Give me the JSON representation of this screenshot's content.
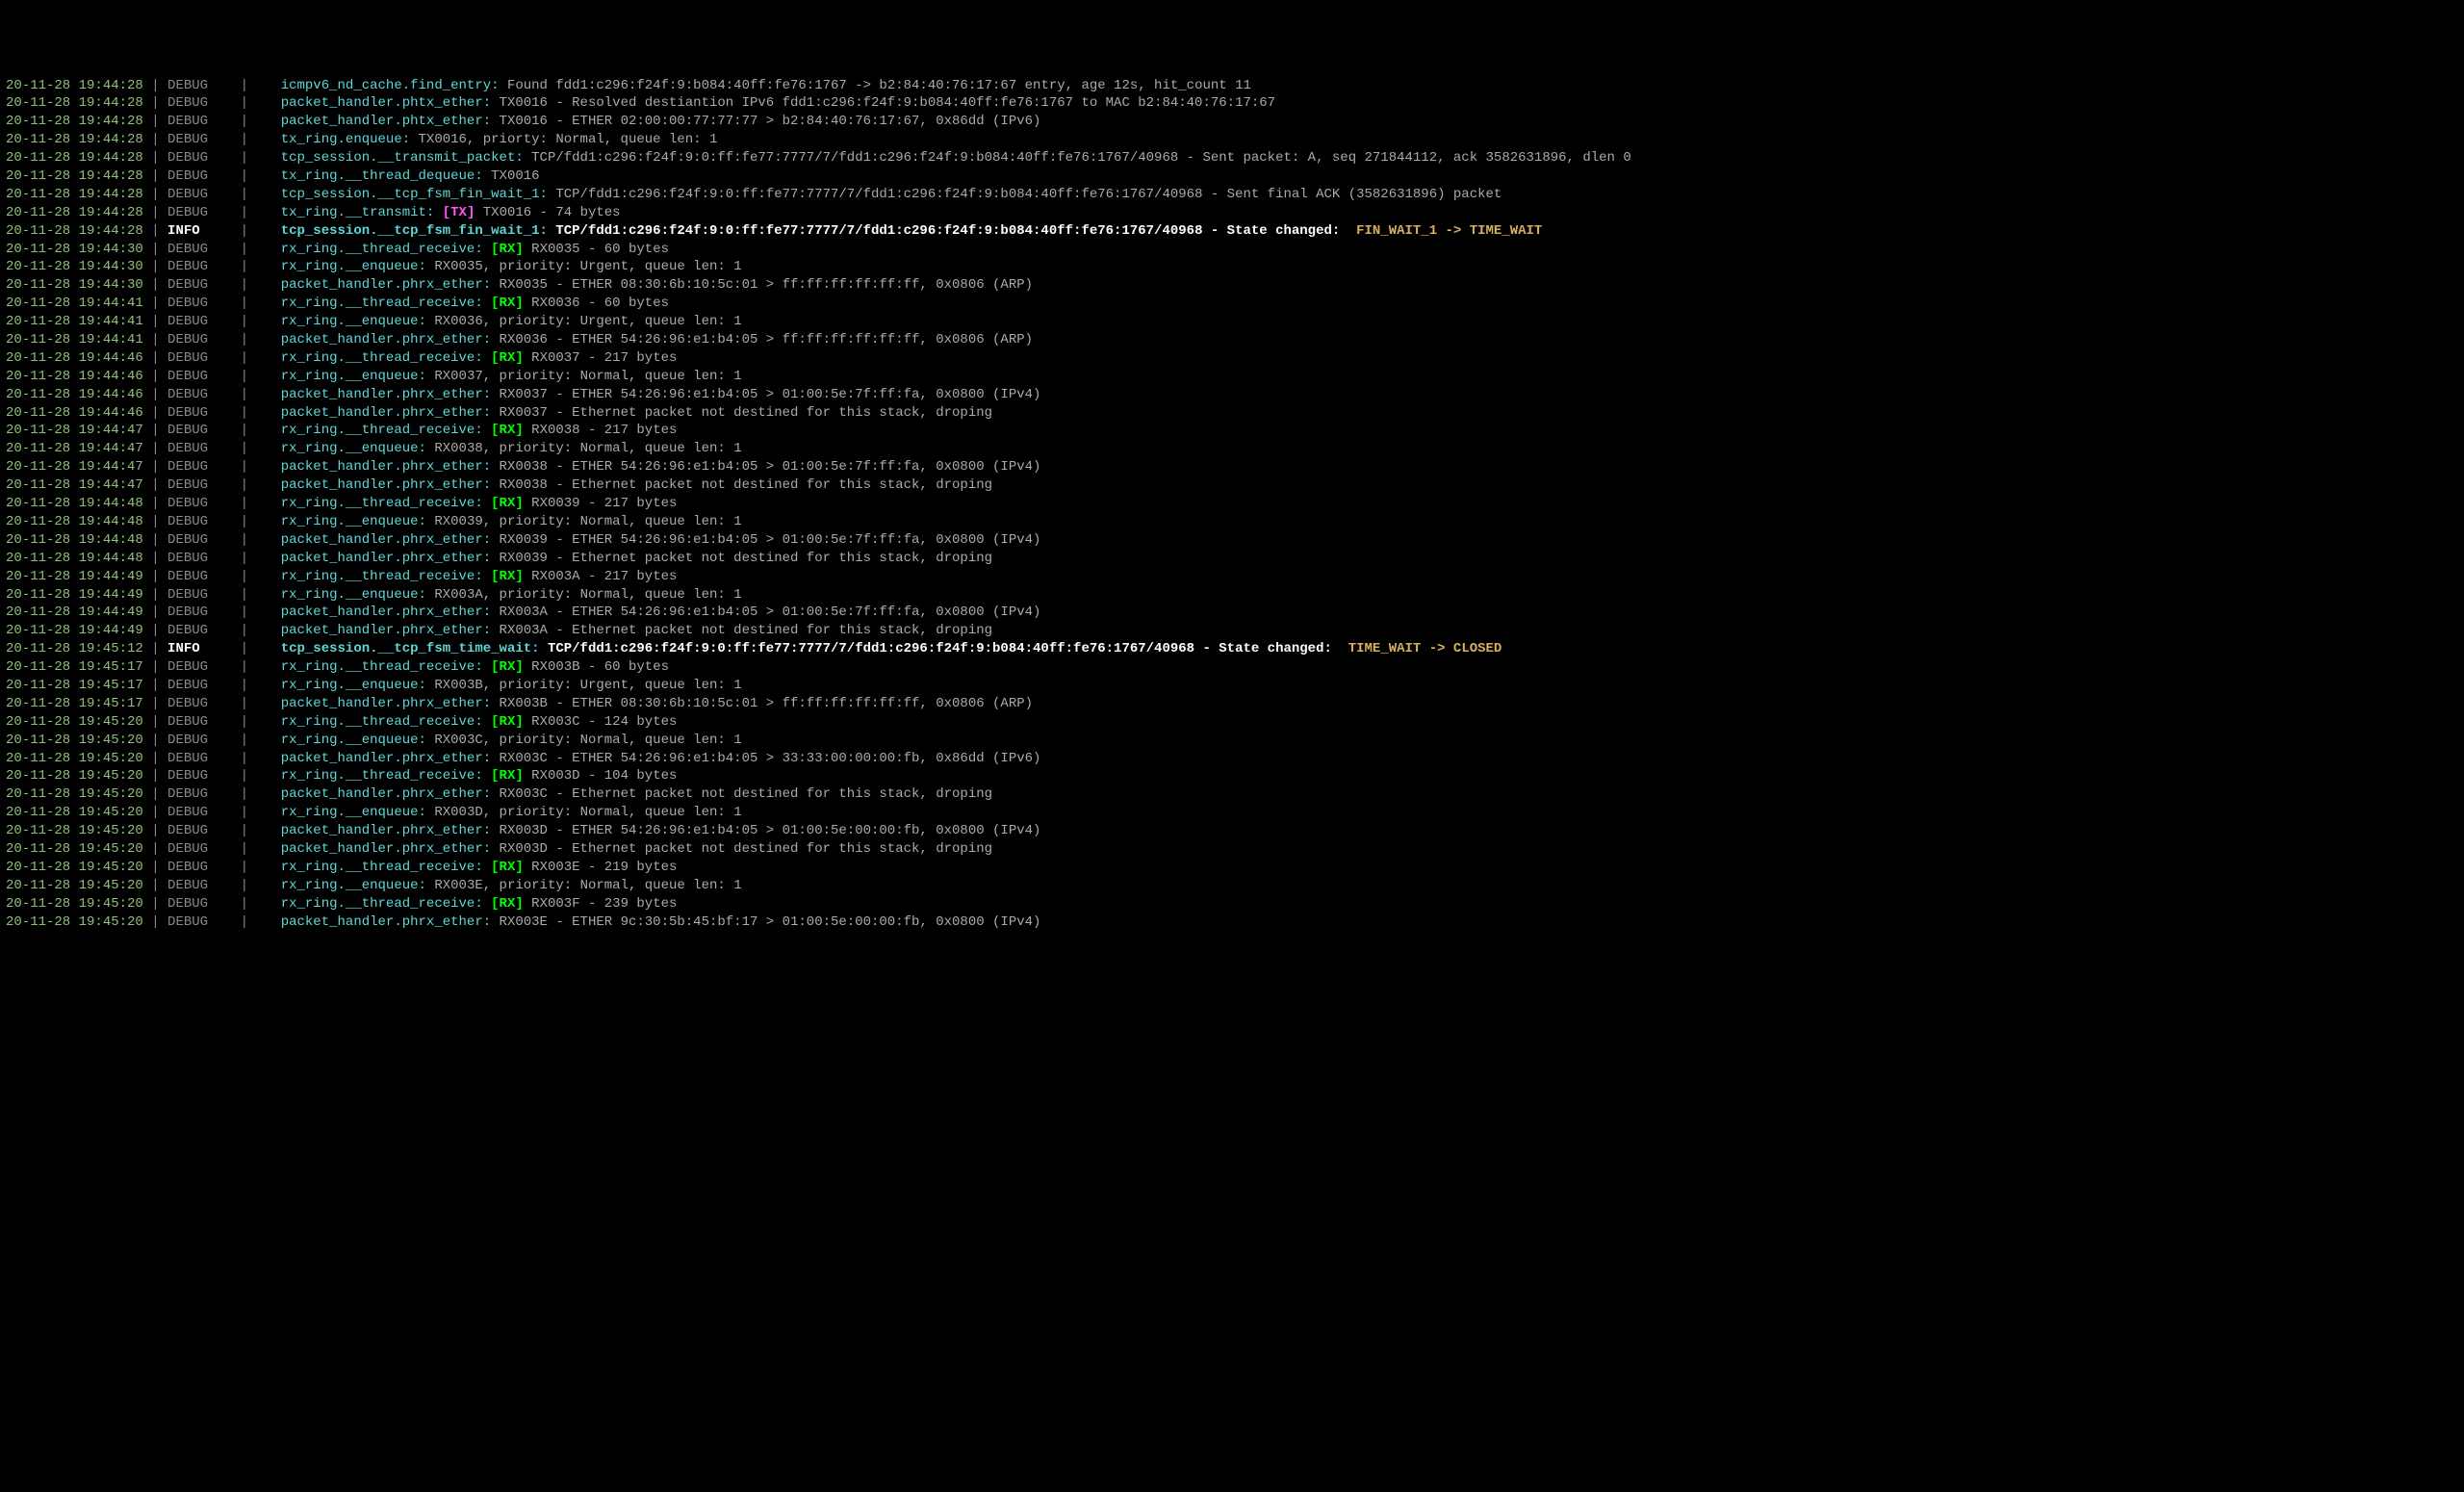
{
  "logs": [
    {
      "ts": "20-11-28 19:44:28",
      "level": "DEBUG",
      "src": "icmpv6_nd_cache.find_entry:",
      "msg": " Found fdd1:c296:f24f:9:b084:40ff:fe76:1767 -> b2:84:40:76:17:67 entry, age 12s, hit_count 11"
    },
    {
      "ts": "20-11-28 19:44:28",
      "level": "DEBUG",
      "src": "packet_handler.phtx_ether:",
      "msg": " TX0016 - Resolved destiantion IPv6 fdd1:c296:f24f:9:b084:40ff:fe76:1767 to MAC b2:84:40:76:17:67"
    },
    {
      "ts": "20-11-28 19:44:28",
      "level": "DEBUG",
      "src": "packet_handler.phtx_ether:",
      "msg": " TX0016 - ETHER 02:00:00:77:77:77 > b2:84:40:76:17:67, 0x86dd (IPv6)"
    },
    {
      "ts": "20-11-28 19:44:28",
      "level": "DEBUG",
      "src": "tx_ring.enqueue:",
      "msg": " TX0016, priorty: Normal, queue len: 1"
    },
    {
      "ts": "20-11-28 19:44:28",
      "level": "DEBUG",
      "src": "tcp_session.__transmit_packet:",
      "msg": " TCP/fdd1:c296:f24f:9:0:ff:fe77:7777/7/fdd1:c296:f24f:9:b084:40ff:fe76:1767/40968 - Sent packet: A, seq 271844112, ack 3582631896, dlen 0"
    },
    {
      "ts": "20-11-28 19:44:28",
      "level": "DEBUG",
      "src": "tx_ring.__thread_dequeue:",
      "msg": " TX0016"
    },
    {
      "ts": "20-11-28 19:44:28",
      "level": "DEBUG",
      "src": "tcp_session.__tcp_fsm_fin_wait_1:",
      "msg": " TCP/fdd1:c296:f24f:9:0:ff:fe77:7777/7/fdd1:c296:f24f:9:b084:40ff:fe76:1767/40968 - Sent final ACK (3582631896) packet"
    },
    {
      "ts": "20-11-28 19:44:28",
      "level": "DEBUG",
      "src": "tx_ring.__transmit:",
      "tag": "TX",
      "msg": " TX0016 - 74 bytes"
    },
    {
      "ts": "20-11-28 19:44:28",
      "level": "INFO",
      "src": "tcp_session.__tcp_fsm_fin_wait_1:",
      "msg": " TCP/fdd1:c296:f24f:9:0:ff:fe77:7777/7/fdd1:c296:f24f:9:b084:40ff:fe76:1767/40968 - State changed: ",
      "state": " FIN_WAIT_1 -> TIME_WAIT"
    },
    {
      "ts": "20-11-28 19:44:30",
      "level": "DEBUG",
      "src": "rx_ring.__thread_receive:",
      "tag": "RX",
      "msg": " RX0035 - 60 bytes"
    },
    {
      "ts": "20-11-28 19:44:30",
      "level": "DEBUG",
      "src": "rx_ring.__enqueue:",
      "msg": " RX0035, priority: Urgent, queue len: 1"
    },
    {
      "ts": "20-11-28 19:44:30",
      "level": "DEBUG",
      "src": "packet_handler.phrx_ether:",
      "msg": " RX0035 - ETHER 08:30:6b:10:5c:01 > ff:ff:ff:ff:ff:ff, 0x0806 (ARP)"
    },
    {
      "ts": "20-11-28 19:44:41",
      "level": "DEBUG",
      "src": "rx_ring.__thread_receive:",
      "tag": "RX",
      "msg": " RX0036 - 60 bytes"
    },
    {
      "ts": "20-11-28 19:44:41",
      "level": "DEBUG",
      "src": "rx_ring.__enqueue:",
      "msg": " RX0036, priority: Urgent, queue len: 1"
    },
    {
      "ts": "20-11-28 19:44:41",
      "level": "DEBUG",
      "src": "packet_handler.phrx_ether:",
      "msg": " RX0036 - ETHER 54:26:96:e1:b4:05 > ff:ff:ff:ff:ff:ff, 0x0806 (ARP)"
    },
    {
      "ts": "20-11-28 19:44:46",
      "level": "DEBUG",
      "src": "rx_ring.__thread_receive:",
      "tag": "RX",
      "msg": " RX0037 - 217 bytes"
    },
    {
      "ts": "20-11-28 19:44:46",
      "level": "DEBUG",
      "src": "rx_ring.__enqueue:",
      "msg": " RX0037, priority: Normal, queue len: 1"
    },
    {
      "ts": "20-11-28 19:44:46",
      "level": "DEBUG",
      "src": "packet_handler.phrx_ether:",
      "msg": " RX0037 - ETHER 54:26:96:e1:b4:05 > 01:00:5e:7f:ff:fa, 0x0800 (IPv4)"
    },
    {
      "ts": "20-11-28 19:44:46",
      "level": "DEBUG",
      "src": "packet_handler.phrx_ether:",
      "msg": " RX0037 - Ethernet packet not destined for this stack, droping"
    },
    {
      "ts": "20-11-28 19:44:47",
      "level": "DEBUG",
      "src": "rx_ring.__thread_receive:",
      "tag": "RX",
      "msg": " RX0038 - 217 bytes"
    },
    {
      "ts": "20-11-28 19:44:47",
      "level": "DEBUG",
      "src": "rx_ring.__enqueue:",
      "msg": " RX0038, priority: Normal, queue len: 1"
    },
    {
      "ts": "20-11-28 19:44:47",
      "level": "DEBUG",
      "src": "packet_handler.phrx_ether:",
      "msg": " RX0038 - ETHER 54:26:96:e1:b4:05 > 01:00:5e:7f:ff:fa, 0x0800 (IPv4)"
    },
    {
      "ts": "20-11-28 19:44:47",
      "level": "DEBUG",
      "src": "packet_handler.phrx_ether:",
      "msg": " RX0038 - Ethernet packet not destined for this stack, droping"
    },
    {
      "ts": "20-11-28 19:44:48",
      "level": "DEBUG",
      "src": "rx_ring.__thread_receive:",
      "tag": "RX",
      "msg": " RX0039 - 217 bytes"
    },
    {
      "ts": "20-11-28 19:44:48",
      "level": "DEBUG",
      "src": "rx_ring.__enqueue:",
      "msg": " RX0039, priority: Normal, queue len: 1"
    },
    {
      "ts": "20-11-28 19:44:48",
      "level": "DEBUG",
      "src": "packet_handler.phrx_ether:",
      "msg": " RX0039 - ETHER 54:26:96:e1:b4:05 > 01:00:5e:7f:ff:fa, 0x0800 (IPv4)"
    },
    {
      "ts": "20-11-28 19:44:48",
      "level": "DEBUG",
      "src": "packet_handler.phrx_ether:",
      "msg": " RX0039 - Ethernet packet not destined for this stack, droping"
    },
    {
      "ts": "20-11-28 19:44:49",
      "level": "DEBUG",
      "src": "rx_ring.__thread_receive:",
      "tag": "RX",
      "msg": " RX003A - 217 bytes"
    },
    {
      "ts": "20-11-28 19:44:49",
      "level": "DEBUG",
      "src": "rx_ring.__enqueue:",
      "msg": " RX003A, priority: Normal, queue len: 1"
    },
    {
      "ts": "20-11-28 19:44:49",
      "level": "DEBUG",
      "src": "packet_handler.phrx_ether:",
      "msg": " RX003A - ETHER 54:26:96:e1:b4:05 > 01:00:5e:7f:ff:fa, 0x0800 (IPv4)"
    },
    {
      "ts": "20-11-28 19:44:49",
      "level": "DEBUG",
      "src": "packet_handler.phrx_ether:",
      "msg": " RX003A - Ethernet packet not destined for this stack, droping"
    },
    {
      "ts": "20-11-28 19:45:12",
      "level": "INFO",
      "src": "tcp_session.__tcp_fsm_time_wait:",
      "msg": " TCP/fdd1:c296:f24f:9:0:ff:fe77:7777/7/fdd1:c296:f24f:9:b084:40ff:fe76:1767/40968 - State changed: ",
      "state": " TIME_WAIT -> CLOSED"
    },
    {
      "ts": "20-11-28 19:45:17",
      "level": "DEBUG",
      "src": "rx_ring.__thread_receive:",
      "tag": "RX",
      "msg": " RX003B - 60 bytes"
    },
    {
      "ts": "20-11-28 19:45:17",
      "level": "DEBUG",
      "src": "rx_ring.__enqueue:",
      "msg": " RX003B, priority: Urgent, queue len: 1"
    },
    {
      "ts": "20-11-28 19:45:17",
      "level": "DEBUG",
      "src": "packet_handler.phrx_ether:",
      "msg": " RX003B - ETHER 08:30:6b:10:5c:01 > ff:ff:ff:ff:ff:ff, 0x0806 (ARP)"
    },
    {
      "ts": "20-11-28 19:45:20",
      "level": "DEBUG",
      "src": "rx_ring.__thread_receive:",
      "tag": "RX",
      "msg": " RX003C - 124 bytes"
    },
    {
      "ts": "20-11-28 19:45:20",
      "level": "DEBUG",
      "src": "rx_ring.__enqueue:",
      "msg": " RX003C, priority: Normal, queue len: 1"
    },
    {
      "ts": "20-11-28 19:45:20",
      "level": "DEBUG",
      "src": "packet_handler.phrx_ether:",
      "msg": " RX003C - ETHER 54:26:96:e1:b4:05 > 33:33:00:00:00:fb, 0x86dd (IPv6)"
    },
    {
      "ts": "20-11-28 19:45:20",
      "level": "DEBUG",
      "src": "rx_ring.__thread_receive:",
      "tag": "RX",
      "msg": " RX003D - 104 bytes"
    },
    {
      "ts": "20-11-28 19:45:20",
      "level": "DEBUG",
      "src": "packet_handler.phrx_ether:",
      "msg": " RX003C - Ethernet packet not destined for this stack, droping"
    },
    {
      "ts": "20-11-28 19:45:20",
      "level": "DEBUG",
      "src": "rx_ring.__enqueue:",
      "msg": " RX003D, priority: Normal, queue len: 1"
    },
    {
      "ts": "20-11-28 19:45:20",
      "level": "DEBUG",
      "src": "packet_handler.phrx_ether:",
      "msg": " RX003D - ETHER 54:26:96:e1:b4:05 > 01:00:5e:00:00:fb, 0x0800 (IPv4)"
    },
    {
      "ts": "20-11-28 19:45:20",
      "level": "DEBUG",
      "src": "packet_handler.phrx_ether:",
      "msg": " RX003D - Ethernet packet not destined for this stack, droping"
    },
    {
      "ts": "20-11-28 19:45:20",
      "level": "DEBUG",
      "src": "rx_ring.__thread_receive:",
      "tag": "RX",
      "msg": " RX003E - 219 bytes"
    },
    {
      "ts": "20-11-28 19:45:20",
      "level": "DEBUG",
      "src": "rx_ring.__enqueue:",
      "msg": " RX003E, priority: Normal, queue len: 1"
    },
    {
      "ts": "20-11-28 19:45:20",
      "level": "DEBUG",
      "src": "rx_ring.__thread_receive:",
      "tag": "RX",
      "msg": " RX003F - 239 bytes"
    },
    {
      "ts": "20-11-28 19:45:20",
      "level": "DEBUG",
      "src": "packet_handler.phrx_ether:",
      "msg": " RX003E - ETHER 9c:30:5b:45:bf:17 > 01:00:5e:00:00:fb, 0x0800 (IPv4)"
    }
  ],
  "labels": {
    "sep": " | ",
    "pad_debug": "DEBUG   ",
    "pad_info": "INFO    ",
    "src_pad": "   ",
    "rx_tag": "[RX]",
    "tx_tag": "[TX]"
  }
}
